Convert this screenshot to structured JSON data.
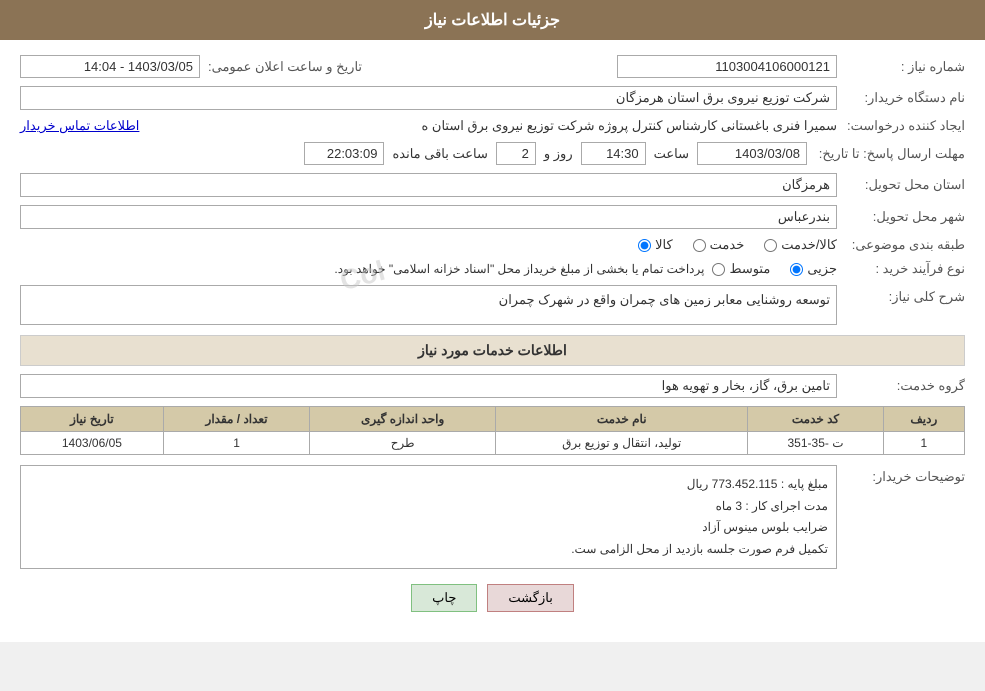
{
  "header": {
    "title": "جزئیات اطلاعات نیاز"
  },
  "fields": {
    "need_number_label": "شماره نیاز :",
    "need_number_value": "1103004106000121",
    "requester_org_label": "نام دستگاه خریدار:",
    "requester_org_value": "شرکت توزیع نیروی برق استان هرمزگان",
    "creator_label": "ایجاد کننده درخواست:",
    "creator_value": "اطلاعات تماس خریدار",
    "creator_prefix": "سمیرا فنری باغستانی کارشناس کنترل پروژه شرکت توزیع نیروی برق استان ه",
    "date_label": "تاریخ و ساعت اعلان عمومی:",
    "date_range": "1403/03/05 - 14:04",
    "deadline_label": "مهلت ارسال پاسخ: تا تاریخ:",
    "deadline_date": "1403/03/08",
    "deadline_time_label": "ساعت",
    "deadline_time": "14:30",
    "deadline_day_label": "روز و",
    "deadline_days": "2",
    "deadline_remaining_label": "ساعت باقی مانده",
    "deadline_remaining": "22:03:09",
    "province_label": "استان محل تحویل:",
    "province_value": "هرمزگان",
    "city_label": "شهر محل تحویل:",
    "city_value": "بندرعباس",
    "category_label": "طبقه بندی موضوعی:",
    "category_options": [
      "کالا",
      "خدمت",
      "کالا/خدمت"
    ],
    "category_selected": "کالا",
    "purchase_type_label": "نوع فرآیند خرید :",
    "purchase_options": [
      "جزیی",
      "متوسط"
    ],
    "purchase_note": "پرداخت تمام یا بخشی از مبلغ خریداز محل \"اسناد خزانه اسلامی\" خواهد بود.",
    "description_label": "شرح کلی نیاز:",
    "description_value": "توسعه روشنایی معابر زمین های چمران واقع در شهرک چمران",
    "services_title": "اطلاعات خدمات مورد نیاز",
    "service_group_label": "گروه خدمت:",
    "service_group_value": "تامین برق، گاز، بخار و تهویه هوا",
    "table_headers": [
      "ردیف",
      "کد خدمت",
      "نام خدمت",
      "واحد اندازه گیری",
      "تعداد / مقدار",
      "تاریخ نیاز"
    ],
    "table_rows": [
      {
        "row": "1",
        "code": "ت -35-351",
        "name": "تولید، انتقال و توزیع برق",
        "unit": "طرح",
        "quantity": "1",
        "date": "1403/06/05"
      }
    ],
    "buyer_desc_label": "توضیحات خریدار:",
    "buyer_desc_value": "مبلغ پایه : 773.452.115 ریال\nمدت اجرای کار : 3 ماه\nضرایب بلوس مینوس آزاد\nتکمیل فرم صورت جلسه بازدید از محل الزامی ست.",
    "btn_back": "بازگشت",
    "btn_print": "چاپ",
    "col_watermark": "Col"
  }
}
